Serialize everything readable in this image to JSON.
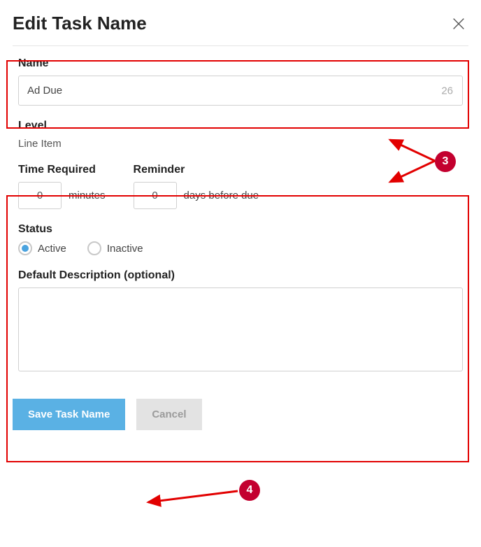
{
  "dialog": {
    "title": "Edit Task Name"
  },
  "name": {
    "label": "Name",
    "value": "Ad Due",
    "remaining": "26"
  },
  "level": {
    "label": "Level",
    "value": "Line Item"
  },
  "time_required": {
    "label": "Time Required",
    "value": "0",
    "unit": "minutes"
  },
  "reminder": {
    "label": "Reminder",
    "value": "0",
    "unit": "days before due"
  },
  "status": {
    "label": "Status",
    "options": {
      "active": "Active",
      "inactive": "Inactive"
    }
  },
  "description": {
    "label": "Default Description (optional)",
    "value": ""
  },
  "buttons": {
    "save": "Save Task Name",
    "cancel": "Cancel"
  },
  "annotations": {
    "badge3": "3",
    "badge4": "4"
  }
}
